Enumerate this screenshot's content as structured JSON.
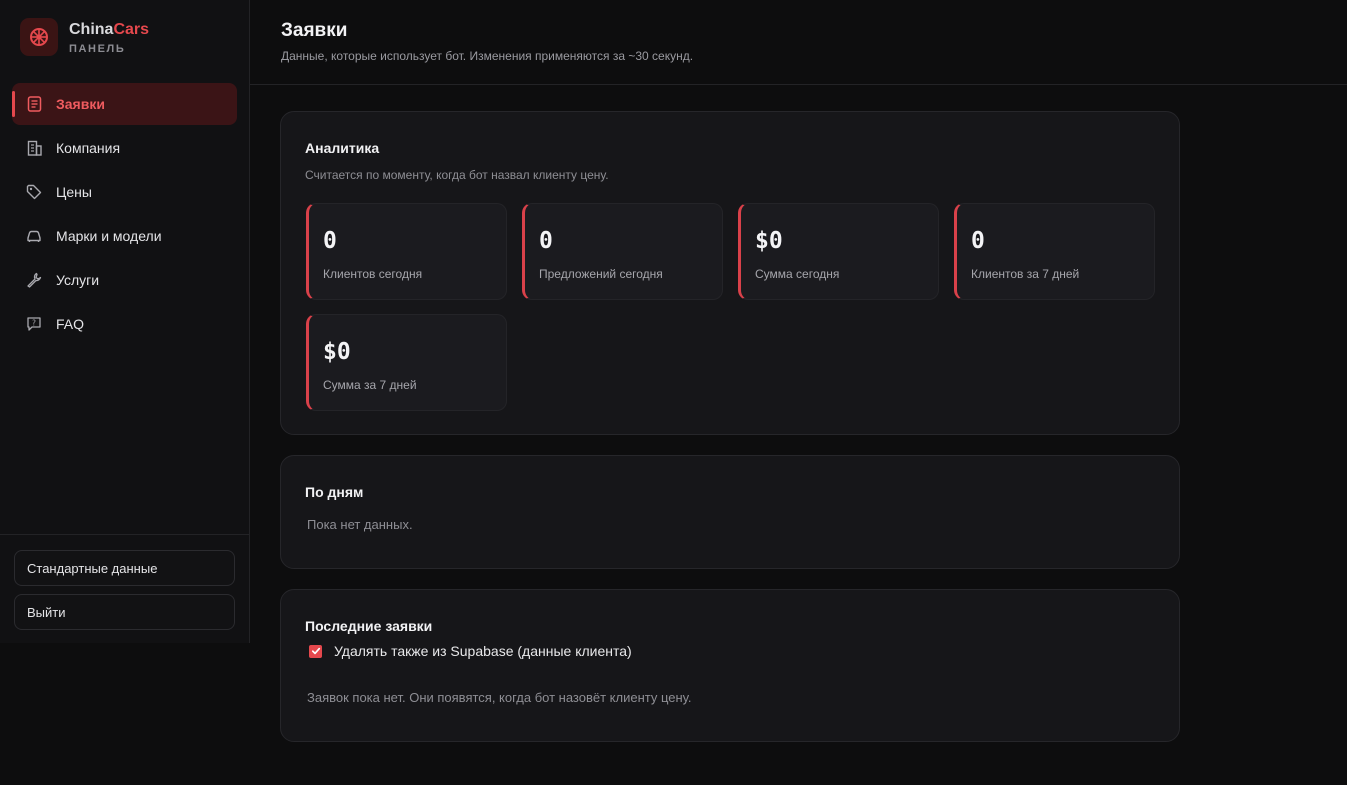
{
  "brand": {
    "name_part1": "China",
    "name_part2": "Cars",
    "subtitle": "ПАНЕЛЬ"
  },
  "sidebar": {
    "items": [
      {
        "label": "Заявки",
        "icon": "document-icon",
        "active": true
      },
      {
        "label": "Компания",
        "icon": "building-icon"
      },
      {
        "label": "Цены",
        "icon": "tag-icon"
      },
      {
        "label": "Марки и модели",
        "icon": "car-icon"
      },
      {
        "label": "Услуги",
        "icon": "wrench-icon"
      },
      {
        "label": "FAQ",
        "icon": "help-chat-icon"
      }
    ],
    "default_data_label": "Стандартные данные",
    "logout_label": "Выйти"
  },
  "header": {
    "title": "Заявки",
    "subtitle": "Данные, которые использует бот. Изменения применяются за ~30 секунд."
  },
  "analytics": {
    "title": "Аналитика",
    "subtitle": "Считается по моменту, когда бот назвал клиенту цену.",
    "stats": [
      {
        "value": "0",
        "label": "Клиентов сегодня"
      },
      {
        "value": "0",
        "label": "Предложений сегодня"
      },
      {
        "value": "$0",
        "label": "Сумма сегодня"
      },
      {
        "value": "0",
        "label": "Клиентов за 7 дней"
      },
      {
        "value": "$0",
        "label": "Сумма за 7 дней"
      }
    ]
  },
  "by_days": {
    "title": "По дням",
    "empty": "Пока нет данных."
  },
  "recent": {
    "title": "Последние заявки",
    "checkbox_label": "Удалять также из Supabase (данные клиента)",
    "checkbox_checked": true,
    "empty": "Заявок пока нет. Они появятся, когда бот назовёт клиенту цену."
  },
  "colors": {
    "accent": "#e5484d",
    "background": "#0d0d0e",
    "card": "#161619"
  }
}
